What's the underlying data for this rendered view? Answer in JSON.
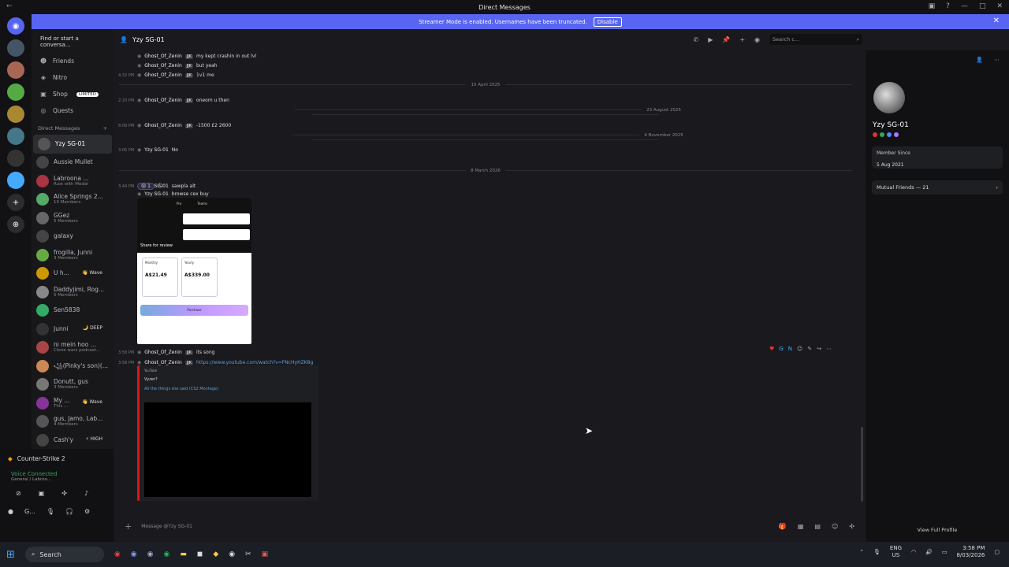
{
  "window": {
    "title": "Direct Messages"
  },
  "banner": {
    "text": "Streamer Mode is enabled. Usernames have been truncated.",
    "button": "Disable"
  },
  "dm": {
    "search_placeholder": "Find or start a conversa...",
    "nav": [
      {
        "label": "Friends",
        "icon": "friends-icon"
      },
      {
        "label": "Nitro",
        "icon": "nitro-icon"
      },
      {
        "label": "Shop",
        "icon": "shop-icon",
        "badge": "LIMITED"
      },
      {
        "label": "Quests",
        "icon": "quests-icon"
      }
    ],
    "section_title": "Direct Messages",
    "add": "+",
    "items": [
      {
        "name": "Yzy SG-01",
        "sub": "",
        "color": "#555"
      },
      {
        "name": "Aussie Mullet",
        "sub": "",
        "color": "#444"
      },
      {
        "name": "Labroona ...",
        "sub": "Rust with Medal",
        "color": "#a34"
      },
      {
        "name": "Alice Springs 2...",
        "sub": "10 Members",
        "color": "#5a6"
      },
      {
        "name": "GGez",
        "sub": "5 Members",
        "color": "#666"
      },
      {
        "name": "galaxy",
        "sub": "",
        "color": "#444"
      },
      {
        "name": "frogilla, Junni",
        "sub": "3 Members",
        "color": "#6a4"
      },
      {
        "name": "U h...",
        "sub": "",
        "color": "#c90",
        "wave": "👋 Wave"
      },
      {
        "name": "Daddyjimi, Rog...",
        "sub": "5 Members",
        "color": "#888"
      },
      {
        "name": "Sen5838",
        "sub": "",
        "color": "#3a6"
      },
      {
        "name": "Junni",
        "sub": "",
        "color": "#333",
        "wave": "🌙 DEEP"
      },
      {
        "name": "ni mein hoo ...",
        "sub": "Clone wars podcast...",
        "color": "#a44"
      },
      {
        "name": "꧁(Pinky's son)(...",
        "sub": "",
        "color": "#c85"
      },
      {
        "name": "Donutt, gus",
        "sub": "3 Members",
        "color": "#777"
      },
      {
        "name": "My ...",
        "sub": "This ...",
        "color": "#839",
        "wave": "👋 Wave"
      },
      {
        "name": "gus, Jamo, Lab...",
        "sub": "4 Members",
        "color": "#555"
      },
      {
        "name": "Cash'y",
        "sub": "",
        "color": "#444",
        "wave": "⚡ HIGH"
      }
    ]
  },
  "userbar": {
    "game": "Counter-Strike 2",
    "voice_title": "Voice Connected",
    "voice_sub": "General / Labroo...",
    "user": "G..."
  },
  "chat": {
    "header_name": "Yzy SG-01",
    "search_placeholder": "Search c...",
    "composer_placeholder": "Message @Yzy SG-01",
    "messages": [
      {
        "time": "",
        "user": "Ghost_Of_Zenin",
        "tag": "JJK",
        "text": "my kept crashin in out lvl"
      },
      {
        "time": "",
        "user": "Ghost_Of_Zenin",
        "tag": "JJK",
        "text": "but yeah"
      },
      {
        "time": "4:32 PM",
        "user": "Ghost_Of_Zenin",
        "tag": "JJK",
        "text": "1v1 me"
      },
      {
        "time": "2:20 PM",
        "user": "Ghost_Of_Zenin",
        "tag": "JJK",
        "text": "oneom u then"
      },
      {
        "time": "8:08 PM",
        "user": "Ghost_Of_Zenin",
        "tag": "JJK",
        "text": "-1500 £2 2600"
      },
      {
        "time": "3:05 PM",
        "user": "Yzy SG-01",
        "tag": "",
        "text": "No"
      },
      {
        "time": "3:44 PM",
        "user": "Yzy SG-01",
        "tag": "",
        "text": "sawpla alt"
      },
      {
        "time": "",
        "user": "Yzy SG-01",
        "tag": "",
        "text": "browse cex buy"
      },
      {
        "time": "3:58 PM",
        "user": "Ghost_Of_Zenin",
        "tag": "JJK",
        "text": "its song"
      },
      {
        "time": "3:58 PM",
        "user": "Ghost_Of_Zenin",
        "tag": "JJK",
        "text": "https://www.youtube.com/watch?v=FNcHyHZK8g"
      }
    ],
    "dividers": [
      "15 April 2025",
      "23 August 2025",
      "4 November 2025",
      "8 March 2026"
    ],
    "reaction": "1",
    "image": {
      "tab1": "Pro",
      "tab2": "Teams",
      "heading": "Share for review",
      "plan1_label": "Monthly",
      "plan1_price": "A$21.49",
      "plan2_label": "Yearly",
      "plan2_price": "A$339.00",
      "button": "Purchase"
    },
    "embed": {
      "provider": "YouTube",
      "author": "Vyzer?",
      "title": "All the things she said (CS2 Montage)"
    }
  },
  "profile": {
    "name": "Yzy SG-01",
    "member_since_label": "Member Since",
    "member_since": "5 Aug 2021",
    "mutual": "Mutual Friends — 21",
    "view_full": "View Full Profile"
  },
  "taskbar": {
    "search": "Search",
    "lang1": "ENG",
    "lang2": "US",
    "time": "3:58 PM",
    "date": "8/03/2026"
  }
}
